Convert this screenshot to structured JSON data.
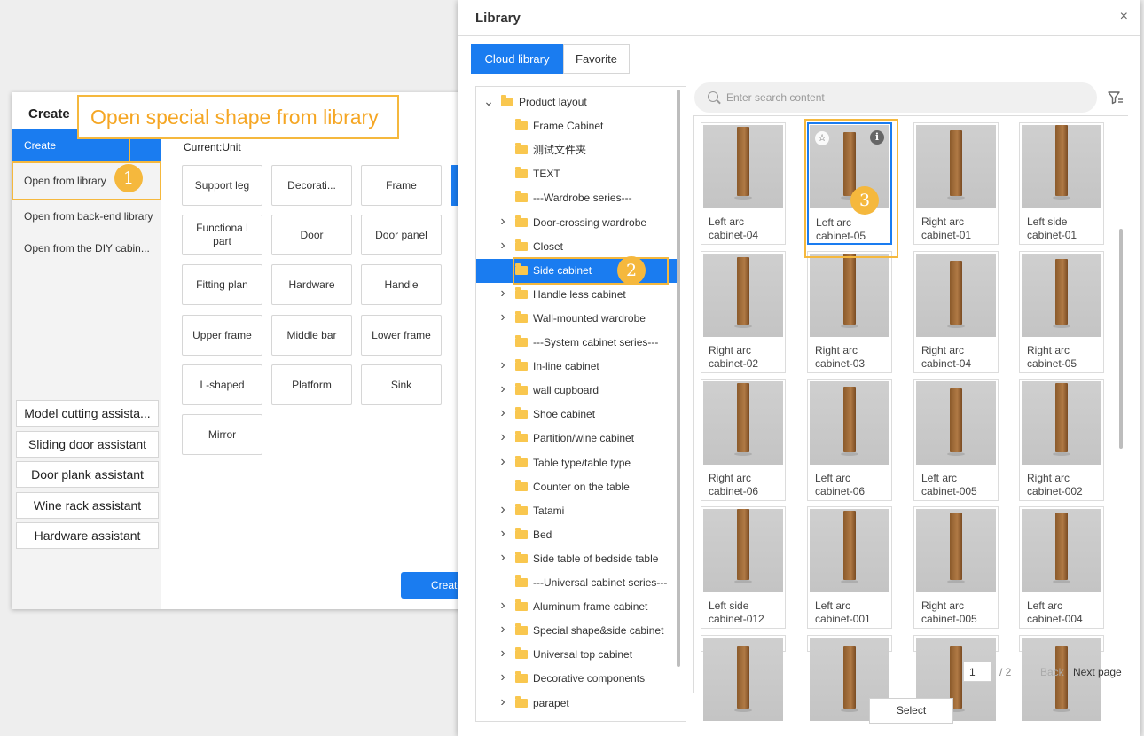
{
  "create_dialog": {
    "title": "Create",
    "nav": [
      {
        "label": "Create"
      },
      {
        "label": "Open from library"
      },
      {
        "label": "Open from back-end library"
      },
      {
        "label": "Open from the DIY cabin..."
      }
    ],
    "current_unit": "Current:Unit",
    "grid": [
      "Support leg",
      "Decorati...",
      "Frame",
      "Functiona l part",
      "Door",
      "Door panel",
      "Fitting plan",
      "Hardware",
      "Handle",
      "Upper frame",
      "Middle bar",
      "Lower frame",
      "L-shaped",
      "Platform",
      "Sink",
      "Mirror"
    ],
    "assistants": [
      "Model cutting assista...",
      "Sliding door assistant",
      "Door plank assistant",
      "Wine rack assistant",
      "Hardware assistant"
    ],
    "create_button": "Create"
  },
  "callouts": {
    "step1_text": "Open special shape from library",
    "badge1": "1",
    "badge2": "2",
    "badge3": "3"
  },
  "library": {
    "title": "Library",
    "close": "×",
    "tabs": [
      "Cloud library",
      "Favorite"
    ],
    "search_placeholder": "Enter search content",
    "tree": [
      {
        "label": "Product layout",
        "arrow": "down"
      },
      {
        "label": "Frame Cabinet",
        "arrow": "none"
      },
      {
        "label": "测试文件夹",
        "arrow": "none"
      },
      {
        "label": "TEXT",
        "arrow": "none"
      },
      {
        "label": "---Wardrobe series---",
        "arrow": "none"
      },
      {
        "label": "Door-crossing wardrobe",
        "arrow": "right"
      },
      {
        "label": "Closet",
        "arrow": "right"
      },
      {
        "label": "Side cabinet",
        "arrow": "none",
        "selected": true
      },
      {
        "label": "Handle less cabinet",
        "arrow": "right"
      },
      {
        "label": "Wall-mounted wardrobe",
        "arrow": "right"
      },
      {
        "label": "---System cabinet series---",
        "arrow": "none"
      },
      {
        "label": "In-line cabinet",
        "arrow": "right"
      },
      {
        "label": "wall cupboard",
        "arrow": "right"
      },
      {
        "label": "Shoe cabinet",
        "arrow": "right"
      },
      {
        "label": "Partition/wine cabinet",
        "arrow": "right"
      },
      {
        "label": "Table type/table type",
        "arrow": "right"
      },
      {
        "label": "Counter on the table",
        "arrow": "none"
      },
      {
        "label": "Tatami",
        "arrow": "right"
      },
      {
        "label": "Bed",
        "arrow": "right"
      },
      {
        "label": "Side table of bedside table",
        "arrow": "right"
      },
      {
        "label": "---Universal cabinet series---",
        "arrow": "none"
      },
      {
        "label": "Aluminum frame cabinet",
        "arrow": "right"
      },
      {
        "label": "Special shape&side cabinet",
        "arrow": "right"
      },
      {
        "label": "Universal top cabinet",
        "arrow": "right"
      },
      {
        "label": "Decorative components",
        "arrow": "right"
      },
      {
        "label": "parapet",
        "arrow": "right"
      }
    ],
    "items": [
      {
        "name": "Left arc cabinet-04",
        "h": 78
      },
      {
        "name": "Left arc cabinet-05",
        "h": 72,
        "selected": true
      },
      {
        "name": "Right arc cabinet-01",
        "h": 74
      },
      {
        "name": "Left side cabinet-01",
        "h": 80
      },
      {
        "name": "Right arc cabinet-02",
        "h": 76
      },
      {
        "name": "Right arc cabinet-03",
        "h": 80
      },
      {
        "name": "Right arc cabinet-04",
        "h": 72
      },
      {
        "name": "Right arc cabinet-05",
        "h": 74
      },
      {
        "name": "Right arc cabinet-06",
        "h": 78
      },
      {
        "name": "Left arc cabinet-06",
        "h": 74
      },
      {
        "name": "Left arc cabinet-005",
        "h": 72
      },
      {
        "name": "Right arc cabinet-002",
        "h": 78
      },
      {
        "name": "Left side cabinet-012",
        "h": 80
      },
      {
        "name": "Left arc cabinet-001",
        "h": 78
      },
      {
        "name": "Right arc cabinet-005",
        "h": 76
      },
      {
        "name": "Left arc cabinet-004",
        "h": 76
      },
      {
        "name": "",
        "h": 70
      },
      {
        "name": "",
        "h": 70
      },
      {
        "name": "",
        "h": 70
      },
      {
        "name": "",
        "h": 70
      }
    ],
    "pagination": {
      "current": "1",
      "total": "/ 2",
      "back": "Back",
      "next": "Next page"
    },
    "select_button": "Select"
  }
}
